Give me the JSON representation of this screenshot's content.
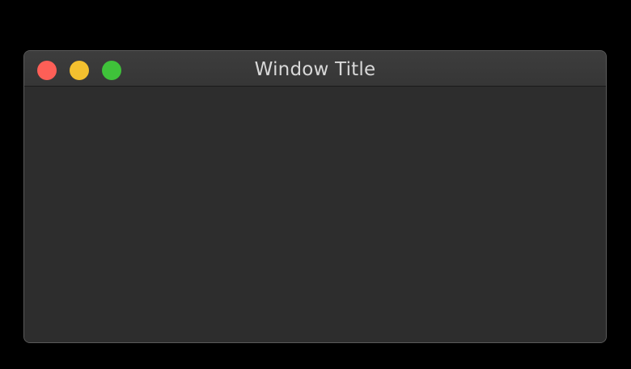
{
  "window": {
    "title": "Window Title"
  },
  "colors": {
    "background": "#000000",
    "window_body": "#2d2d2d",
    "close": "#fe5f57",
    "minimize": "#febc2e",
    "zoom": "#28c840"
  },
  "controls": [
    {
      "name": "close-button",
      "color": "#fe5f57"
    },
    {
      "name": "minimize-button",
      "color": "#f3c02f"
    },
    {
      "name": "zoom-button",
      "color": "#3fc23a"
    }
  ]
}
